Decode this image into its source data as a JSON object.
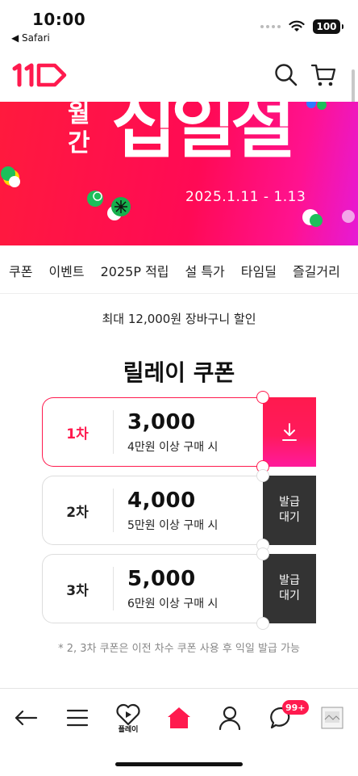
{
  "status_bar": {
    "time": "10:00",
    "back_label": "◀ Safari",
    "battery": "100"
  },
  "header": {
    "logo_text": "11",
    "search_icon": "search-icon",
    "cart_icon": "cart-icon"
  },
  "banner": {
    "vertical_text": [
      "월",
      "간"
    ],
    "big_text": [
      "십",
      "일",
      "절"
    ],
    "date_range": "2025.1.11 - 1.13"
  },
  "categories": [
    "쿠폰",
    "이벤트",
    "2025P 적립",
    "설 특가",
    "타임딜",
    "즐길거리"
  ],
  "coupon_section": {
    "subtitle": "최대 12,000원 장바구니 할인",
    "title": "릴레이 쿠폰",
    "coupons": [
      {
        "stage": "1차",
        "amount": "3,000",
        "condition": "4만원 이상 구매 시",
        "action": "download-icon",
        "active": true
      },
      {
        "stage": "2차",
        "amount": "4,000",
        "condition": "5만원 이상 구매 시",
        "action_line1": "발급",
        "action_line2": "대기",
        "active": false
      },
      {
        "stage": "3차",
        "amount": "5,000",
        "condition": "6만원 이상 구매 시",
        "action_line1": "발급",
        "action_line2": "대기",
        "active": false
      }
    ],
    "footnote": "* 2, 3차 쿠폰은 이전 차수 쿠폰 사용 후 익일 발급 가능"
  },
  "tabbar": {
    "items": [
      "back-arrow-icon",
      "menu-icon",
      "play-icon",
      "home-icon",
      "person-icon",
      "chat-icon",
      "thumbnail-icon"
    ],
    "play_label": "플레이",
    "chat_badge": "99+"
  },
  "colors": {
    "brand": "#ff1a4e",
    "banner_start": "#ff1a3d",
    "banner_end": "#e61ad6",
    "dark_button": "#333333"
  }
}
